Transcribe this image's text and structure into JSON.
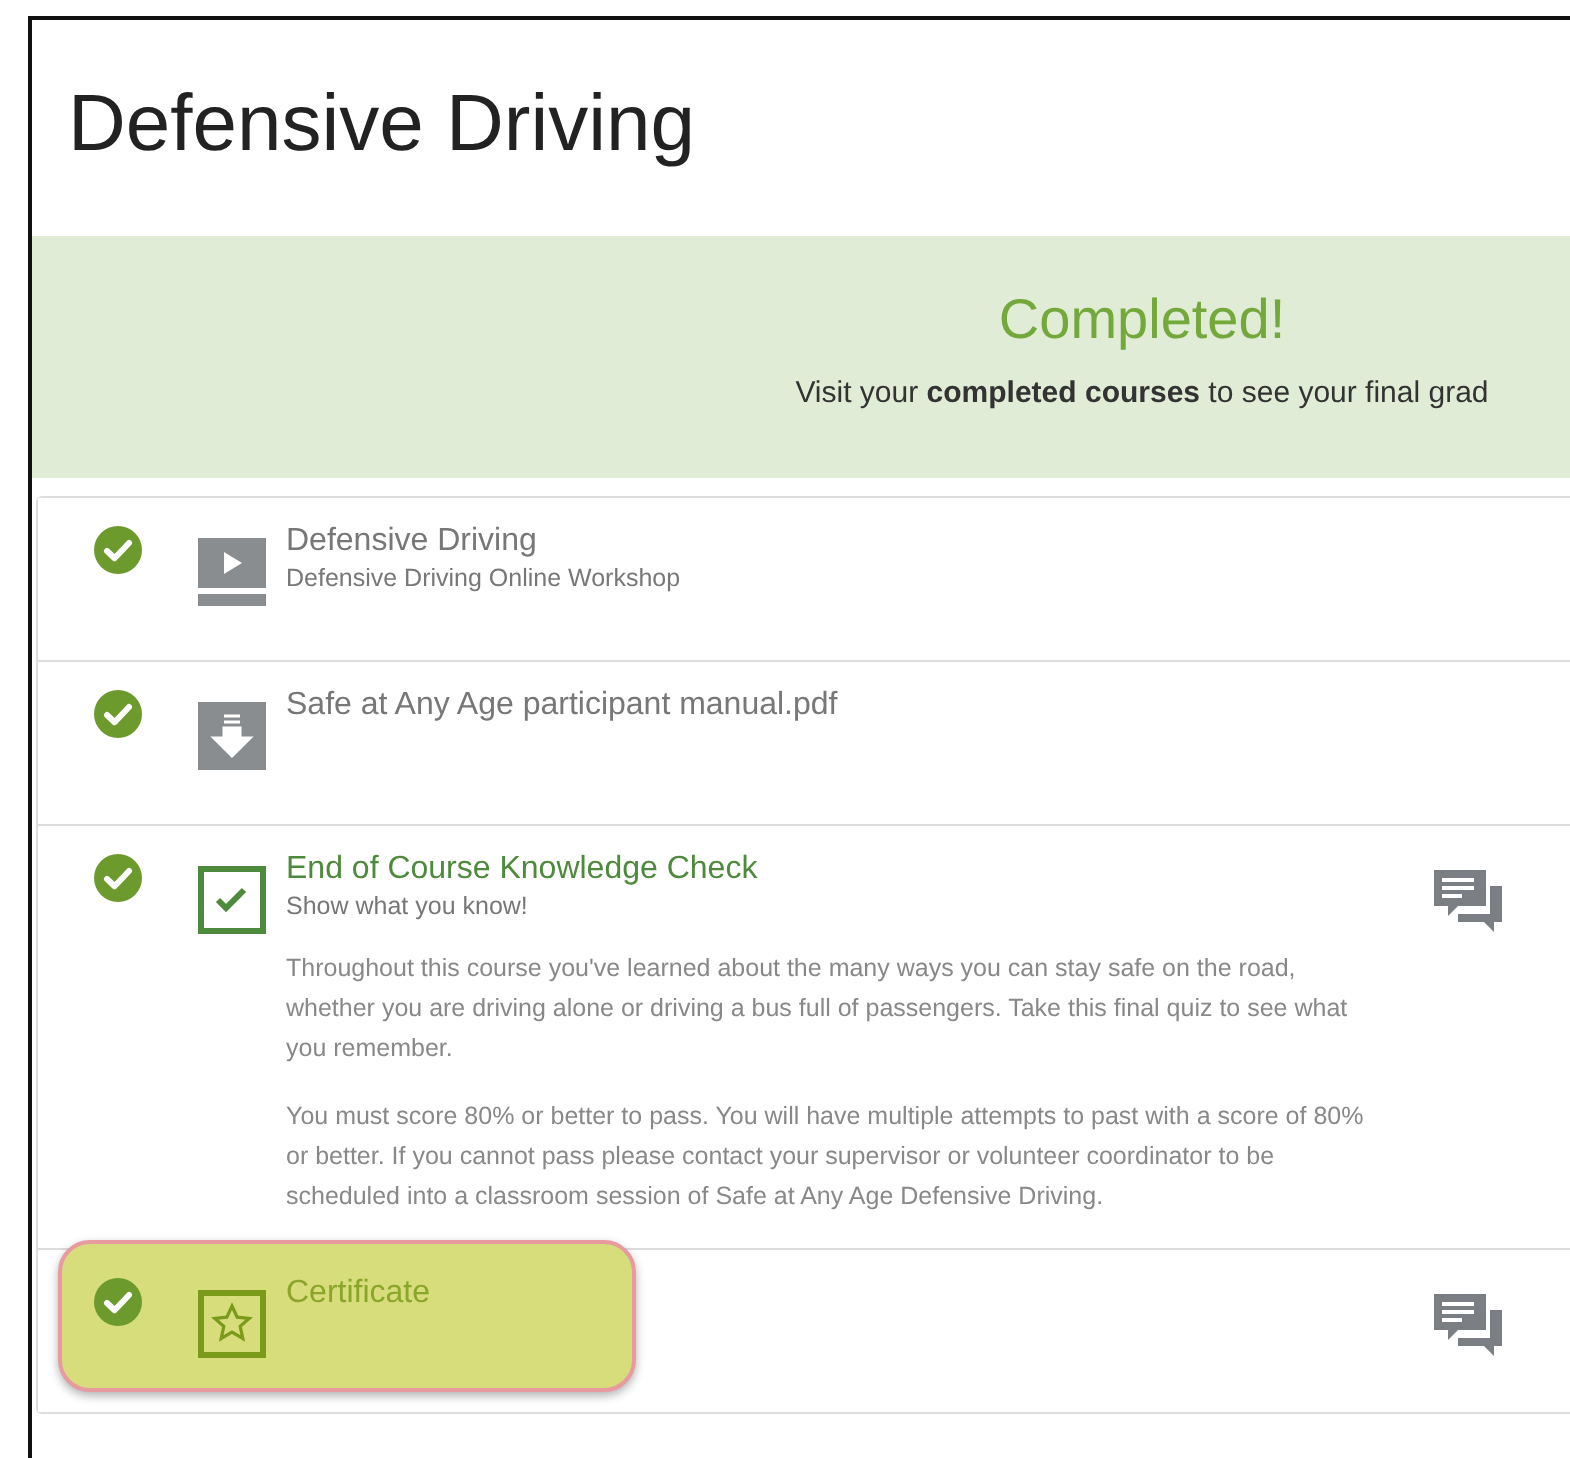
{
  "page_title": "Defensive Driving",
  "banner": {
    "heading": "Completed!",
    "message": "Visit your **completed courses** to see your final grad"
  },
  "items": [
    {
      "kind": "video",
      "title": "Defensive Driving",
      "subtitle": "Defensive Driving Online Workshop",
      "completed": true,
      "linked": false,
      "has_comments": false,
      "highlighted": false
    },
    {
      "kind": "download",
      "title": "Safe at Any Age participant manual.pdf",
      "completed": true,
      "linked": false,
      "has_comments": false,
      "highlighted": false
    },
    {
      "kind": "quiz",
      "title": "End of Course Knowledge Check",
      "subtitle": "Show what you know!",
      "description": [
        "Throughout this course you've learned about the many ways you can stay safe on the road, whether you are driving alone or driving a bus full of passengers.  Take this final quiz to see what you remember.",
        "You must score 80% or better to pass.  You will have multiple attempts to past with a score of 80% or better.  If you cannot pass please contact your supervisor or volunteer coordinator to be scheduled into a classroom session of Safe at Any Age Defensive Driving."
      ],
      "completed": true,
      "linked": true,
      "has_comments": true,
      "highlighted": false
    },
    {
      "kind": "certificate",
      "title": "Certificate",
      "completed": true,
      "linked": true,
      "has_comments": true,
      "highlighted": true
    }
  ]
}
